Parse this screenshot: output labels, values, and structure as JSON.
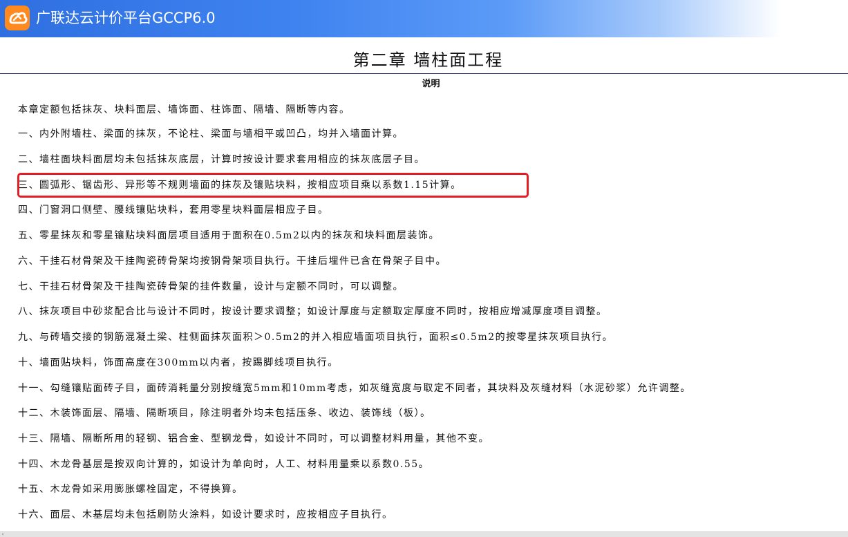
{
  "app": {
    "title": "广联达云计价平台GCCP6.0",
    "logo_icon": "glodon-logo-icon"
  },
  "document": {
    "chapter_title": "第二章 墙柱面工程",
    "subtitle": "说明",
    "paragraphs": [
      "本章定额包括抹灰、块料面层、墙饰面、柱饰面、隔墙、隔断等内容。",
      "一、内外附墙柱、梁面的抹灰，不论柱、梁面与墙相平或凹凸，均并入墙面计算。",
      "二、墙柱面块料面层均未包括抹灰底层，计算时按设计要求套用相应的抹灰底层子目。",
      "三、圆弧形、锯齿形、异形等不规则墙面的抹灰及镶贴块料，按相应项目乘以系数1.15计算。",
      "四、门窗洞口侧壁、腰线镶贴块料，套用零星块料面层相应子目。",
      "五、零星抹灰和零星镶贴块料面层项目适用于面积在0.5m2以内的抹灰和块料面层装饰。",
      "六、干挂石材骨架及干挂陶瓷砖骨架均按钢骨架项目执行。干挂后埋件已含在骨架子目中。",
      "七、干挂石材骨架及干挂陶瓷砖骨架的挂件数量，设计与定额不同时，可以调整。",
      "八、抹灰项目中砂浆配合比与设计不同时，按设计要求调整；如设计厚度与定额取定厚度不同时，按相应增减厚度项目调整。",
      "九、与砖墙交接的钢筋混凝土梁、柱侧面抹灰面积＞0.5m2的并入相应墙面项目执行，面积≤0.5m2的按零星抹灰项目执行。",
      "十、墙面贴块料，饰面高度在300mm以内者，按踢脚线项目执行。",
      "十一、勾缝镶贴面砖子目，面砖消耗量分别按缝宽5mm和10mm考虑，如灰缝宽度与取定不同者，其块料及灰缝材料（水泥砂浆）允许调整。",
      "十二、木装饰面层、隔墙、隔断项目，除注明者外均未包括压条、收边、装饰线（板）。",
      "十三、隔墙、隔断所用的轻钢、铝合金、型钢龙骨，如设计不同时，可以调整材料用量，其他不变。",
      "十四、木龙骨基层是按双向计算的，如设计为单向时，人工、材料用量乘以系数0.55。",
      "十五、木龙骨如采用膨胀螺栓固定，不得换算。",
      "十六、面层、木基层均未包括刷防火涂料，如设计要求时，应按相应子目执行。"
    ],
    "highlighted_paragraph_index": 3
  },
  "colors": {
    "titlebar_blue": "#2f6fe0",
    "logo_orange": "#ff8a1f",
    "highlight_red": "#e51c23",
    "rule_navy": "#1f2a6b"
  },
  "scrollbar": {
    "left_arrow_icon": "scroll-left-arrow-icon"
  }
}
